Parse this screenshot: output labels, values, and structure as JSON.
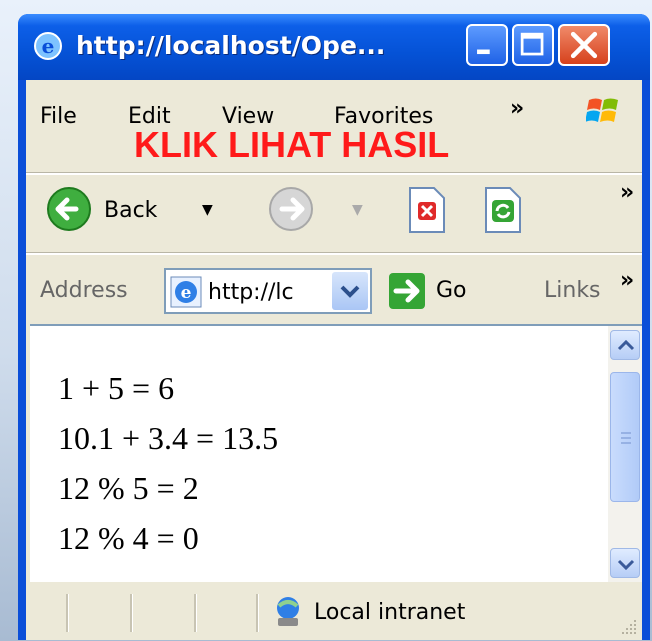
{
  "window": {
    "title": "http://localhost/Ope..."
  },
  "menu": {
    "items": [
      "File",
      "Edit",
      "View",
      "Favorites"
    ],
    "more": "»"
  },
  "overlay_text": "KLIK LIHAT HASIL",
  "toolbar": {
    "back_label": "Back",
    "dropdown_glyph": "▼",
    "more": "»"
  },
  "address": {
    "label": "Address",
    "value": "http://lc",
    "go_label": "Go",
    "links_label": "Links",
    "more": "»"
  },
  "content": {
    "lines": [
      "1 + 5 = 6",
      "10.1 + 3.4 = 13.5",
      "12 % 5 = 2",
      "12 % 4 = 0"
    ]
  },
  "status": {
    "zone": "Local intranet"
  },
  "icons": {
    "title": "ie-icon",
    "back": "back-arrow-icon",
    "forward": "forward-arrow-icon",
    "stop": "stop-icon",
    "refresh": "refresh-icon",
    "go": "go-arrow-icon",
    "zone": "local-intranet-icon",
    "windows_logo": "windows-logo-icon"
  },
  "colors": {
    "titlebar": "#0552d6",
    "overlay": "#ff1a1a",
    "chrome": "#ece9d8",
    "back_button": "#2e9f2e"
  }
}
